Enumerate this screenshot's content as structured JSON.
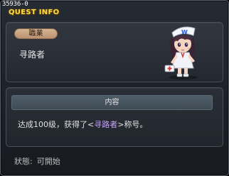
{
  "window": {
    "id_text": "35936-0",
    "title": "QUEST INFO"
  },
  "header": {
    "job_badge": "職業",
    "job_name": "寻路者",
    "npc_icon": "npc-nurse-character-icon"
  },
  "content": {
    "title": "内容",
    "text_before": "达成100级，获得了",
    "bracket_open": "<",
    "highlight": "寻路者",
    "bracket_close": ">",
    "text_after": "称号。"
  },
  "status": {
    "label": "狀態:",
    "value": "可開始"
  },
  "colors": {
    "title": "#ffd94a",
    "highlight": "#c6a3ff",
    "badge": "#c9a580",
    "content_header": "#475560"
  }
}
